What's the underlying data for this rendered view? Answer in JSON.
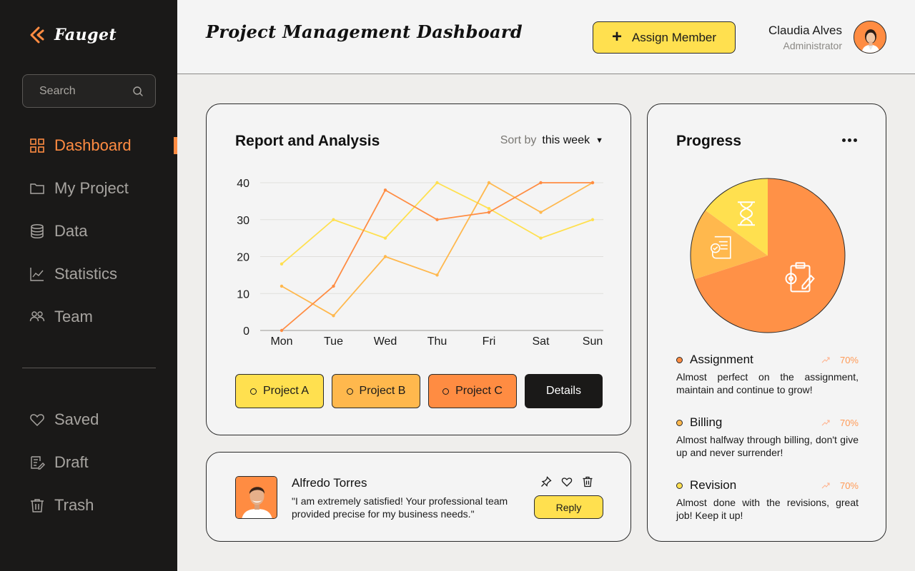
{
  "brand": {
    "name": "Fauget"
  },
  "search": {
    "placeholder": "Search"
  },
  "nav": {
    "items": [
      {
        "label": "Dashboard"
      },
      {
        "label": "My Project"
      },
      {
        "label": "Data"
      },
      {
        "label": "Statistics"
      },
      {
        "label": "Team"
      }
    ],
    "secondary": [
      {
        "label": "Saved"
      },
      {
        "label": "Draft"
      },
      {
        "label": "Trash"
      }
    ]
  },
  "header": {
    "title": "Project Management Dashboard",
    "assign_label": "Assign Member",
    "user_name": "Claudia Alves",
    "user_role": "Administrator"
  },
  "report": {
    "title": "Report and Analysis",
    "sort_label": "Sort by",
    "sort_value": "this week",
    "projects": [
      "Project A",
      "Project B",
      "Project C"
    ],
    "details_label": "Details"
  },
  "chart_data": {
    "type": "line",
    "categories": [
      "Mon",
      "Tue",
      "Wed",
      "Thu",
      "Fri",
      "Sat",
      "Sun"
    ],
    "series": [
      {
        "name": "Project A",
        "color": "#ffe04f",
        "values": [
          18,
          30,
          25,
          40,
          33,
          25,
          30
        ]
      },
      {
        "name": "Project B",
        "color": "#ffb84d",
        "values": [
          12,
          4,
          20,
          15,
          40,
          32,
          40
        ]
      },
      {
        "name": "Project C",
        "color": "#ff8c42",
        "values": [
          0,
          12,
          38,
          30,
          32,
          40,
          40
        ]
      }
    ],
    "yticks": [
      0,
      10,
      20,
      30,
      40
    ],
    "ylim": [
      0,
      40
    ],
    "grid": true
  },
  "review": {
    "name": "Alfredo Torres",
    "text": "\"I am extremely satisfied! Your professional team provided precise for my business needs.\"",
    "reply_label": "Reply"
  },
  "progress": {
    "title": "Progress",
    "pie": [
      {
        "name": "Assignment",
        "value": 70,
        "color": "#ff9147"
      },
      {
        "name": "Billing",
        "value": 15,
        "color": "#ffb84d"
      },
      {
        "name": "Revision",
        "value": 15,
        "color": "#ffe04f"
      }
    ],
    "items": [
      {
        "name": "Assignment",
        "pct": "70%",
        "color": "#ff8c42",
        "desc": "Almost perfect on the assignment, maintain and continue to grow!"
      },
      {
        "name": "Billing",
        "pct": "70%",
        "color": "#ffb84d",
        "desc": "Almost halfway through billing, don't give up and never surrender!"
      },
      {
        "name": "Revision",
        "pct": "70%",
        "color": "#ffe04f",
        "desc": "Almost done with the revisions, great job! Keep it up!"
      }
    ]
  },
  "colors": {
    "accent": "#ff8c42",
    "yellow": "#ffe04f",
    "sidebar": "#1a1918"
  }
}
